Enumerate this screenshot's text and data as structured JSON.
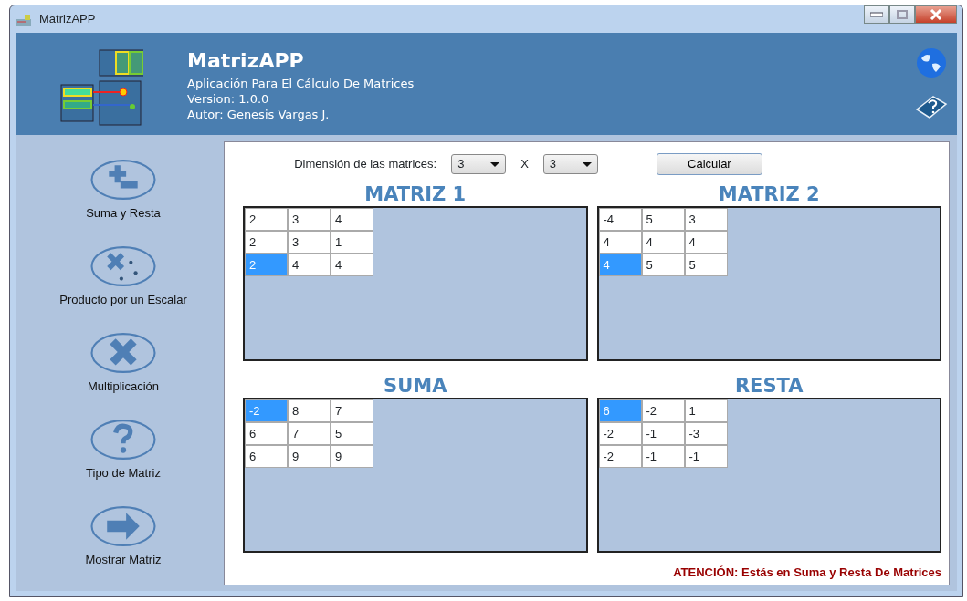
{
  "window": {
    "title": "MatrizAPP"
  },
  "header": {
    "title": "MatrizAPP",
    "lines": [
      "Aplicación Para El Cálculo De Matrices",
      "Version: 1.0.0",
      "Autor: Genesis Vargas J."
    ]
  },
  "sidebar": {
    "items": [
      {
        "kind": "plus-minus",
        "label": "Suma y Resta"
      },
      {
        "kind": "scalar",
        "label": "Producto por un Escalar"
      },
      {
        "kind": "multiply",
        "label": "Multiplicación"
      },
      {
        "kind": "question",
        "label": "Tipo de Matriz"
      },
      {
        "kind": "arrow",
        "label": "Mostrar Matriz"
      }
    ]
  },
  "dimension": {
    "label": "Dimensión de las matrices:",
    "rows": "3",
    "separator": "X",
    "cols": "3"
  },
  "calculate_button": "Calcular",
  "matrices": [
    {
      "title": "MATRIZ 1",
      "rows": [
        [
          {
            "value": "2",
            "selected": false
          },
          {
            "value": "3",
            "selected": false
          },
          {
            "value": "4",
            "selected": false
          }
        ],
        [
          {
            "value": "2",
            "selected": false
          },
          {
            "value": "3",
            "selected": false
          },
          {
            "value": "1",
            "selected": false
          }
        ],
        [
          {
            "value": "2",
            "selected": true
          },
          {
            "value": "4",
            "selected": false
          },
          {
            "value": "4",
            "selected": false
          }
        ]
      ]
    },
    {
      "title": "MATRIZ 2",
      "rows": [
        [
          {
            "value": "-4",
            "selected": false
          },
          {
            "value": "5",
            "selected": false
          },
          {
            "value": "3",
            "selected": false
          }
        ],
        [
          {
            "value": "4",
            "selected": false
          },
          {
            "value": "4",
            "selected": false
          },
          {
            "value": "4",
            "selected": false
          }
        ],
        [
          {
            "value": "4",
            "selected": true
          },
          {
            "value": "5",
            "selected": false
          },
          {
            "value": "5",
            "selected": false
          }
        ]
      ]
    },
    {
      "title": "SUMA",
      "rows": [
        [
          {
            "value": "-2",
            "selected": true
          },
          {
            "value": "8",
            "selected": false
          },
          {
            "value": "7",
            "selected": false
          }
        ],
        [
          {
            "value": "6",
            "selected": false
          },
          {
            "value": "7",
            "selected": false
          },
          {
            "value": "5",
            "selected": false
          }
        ],
        [
          {
            "value": "6",
            "selected": false
          },
          {
            "value": "9",
            "selected": false
          },
          {
            "value": "9",
            "selected": false
          }
        ]
      ]
    },
    {
      "title": "RESTA",
      "rows": [
        [
          {
            "value": "6",
            "selected": true
          },
          {
            "value": "-2",
            "selected": false
          },
          {
            "value": "1",
            "selected": false
          }
        ],
        [
          {
            "value": "-2",
            "selected": false
          },
          {
            "value": "-1",
            "selected": false
          },
          {
            "value": "-3",
            "selected": false
          }
        ],
        [
          {
            "value": "-2",
            "selected": false
          },
          {
            "value": "-1",
            "selected": false
          },
          {
            "value": "-1",
            "selected": false
          }
        ]
      ]
    }
  ],
  "status": "ATENCIÓN: Estás en Suma y Resta De Matrices"
}
